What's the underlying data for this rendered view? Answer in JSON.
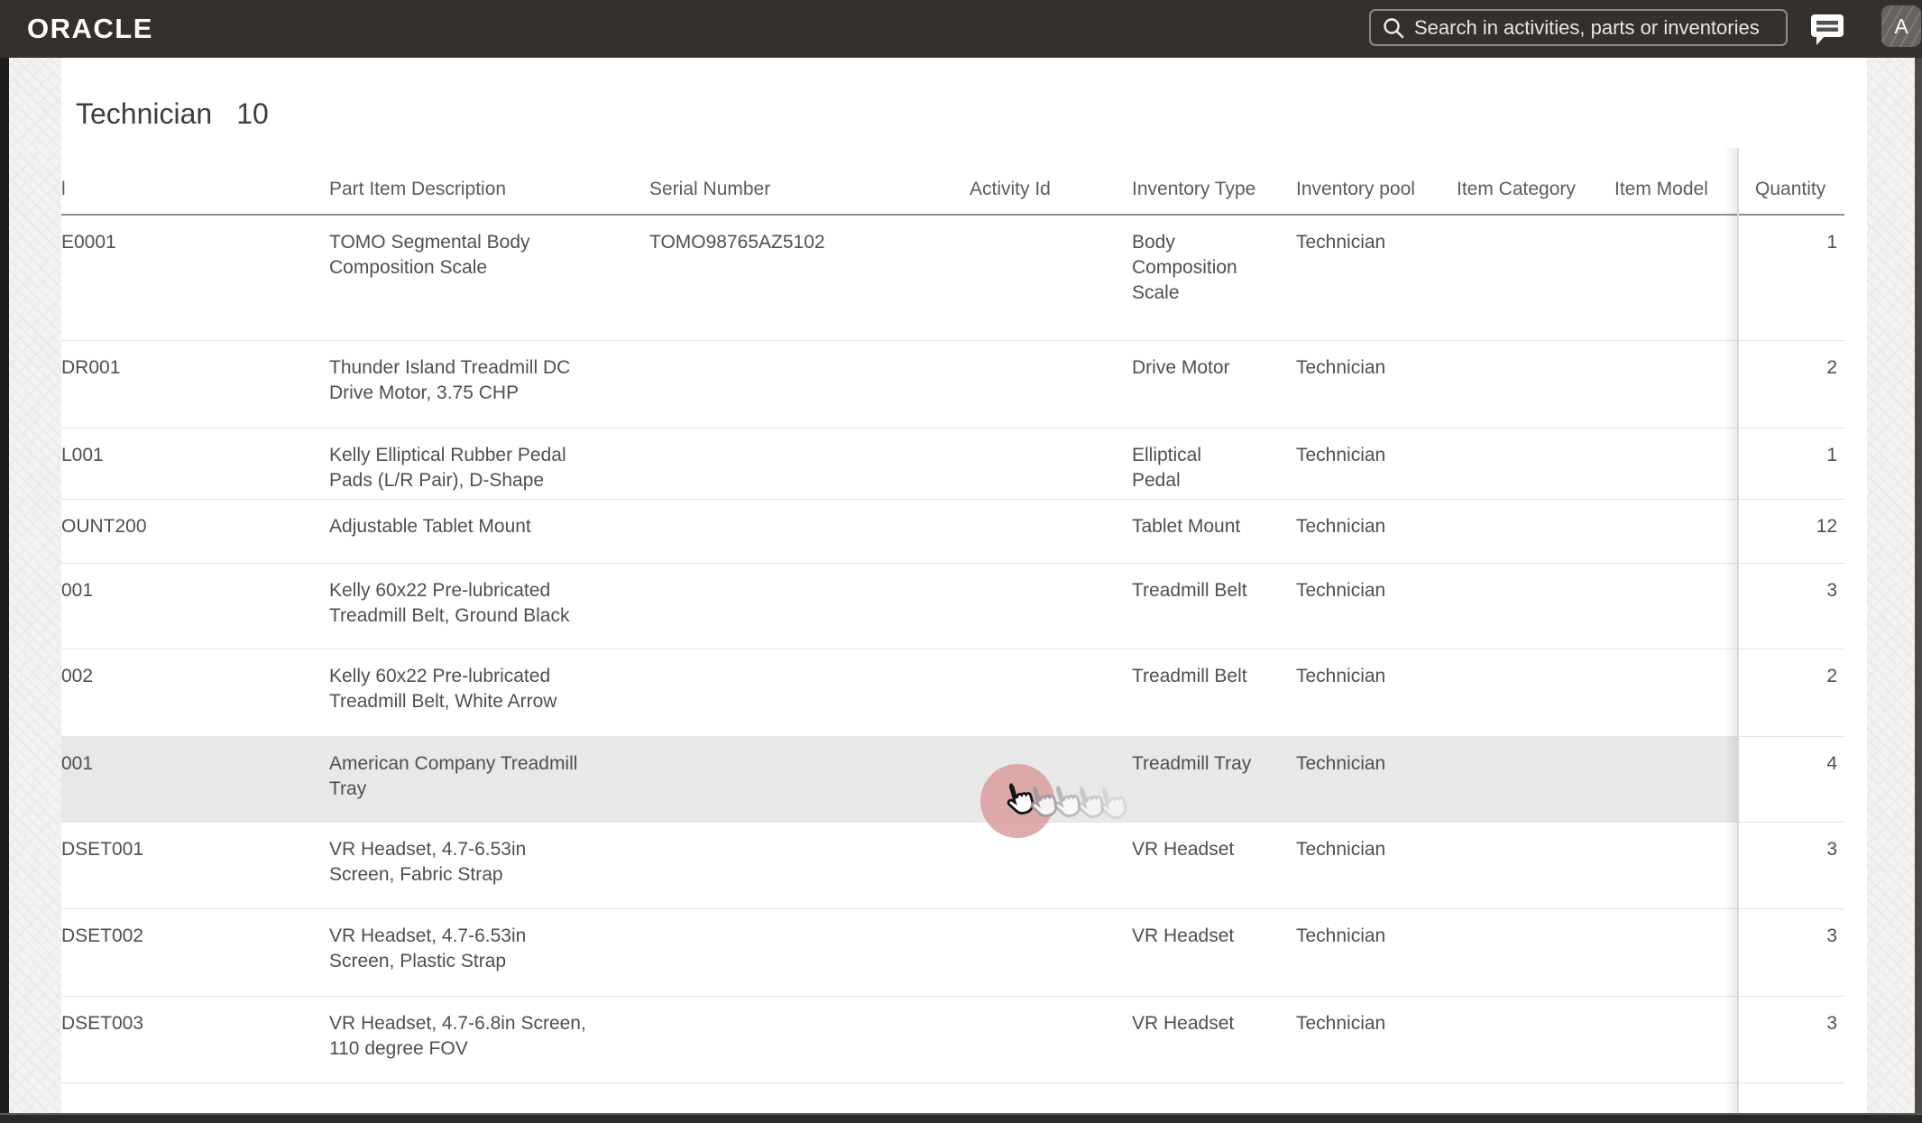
{
  "topbar": {
    "brand": "ORACLE",
    "search_placeholder": "Search in activities, parts or inventories",
    "avatar_letter": "A"
  },
  "page": {
    "title": "Technician",
    "count": "10"
  },
  "table": {
    "headers": {
      "id": "l",
      "desc": "Part Item Description",
      "serial": "Serial Number",
      "activity": "Activity Id",
      "inv_type": "Inventory Type",
      "pool": "Inventory pool",
      "category": "Item Category",
      "model": "Item Model",
      "qty": "Quantity"
    },
    "rows": [
      {
        "id": "E0001",
        "desc": "TOMO Segmental Body\nComposition Scale",
        "serial": "TOMO98765AZ5102",
        "activity": "",
        "inv_type": "Body\nComposition\nScale",
        "pool": "Technician",
        "category": "",
        "model": "",
        "qty": "1"
      },
      {
        "id": "DR001",
        "desc": "Thunder Island Treadmill DC\nDrive Motor, 3.75 CHP",
        "serial": "",
        "activity": "",
        "inv_type": "Drive Motor",
        "pool": "Technician",
        "category": "",
        "model": "",
        "qty": "2"
      },
      {
        "id": "L001",
        "desc": "Kelly Elliptical Rubber Pedal\nPads (L/R Pair), D-Shape",
        "serial": "",
        "activity": "",
        "inv_type": "Elliptical\nPedal",
        "pool": "Technician",
        "category": "",
        "model": "",
        "qty": "1"
      },
      {
        "id": "OUNT200",
        "desc": "Adjustable Tablet Mount",
        "serial": "",
        "activity": "",
        "inv_type": "Tablet Mount",
        "pool": "Technician",
        "category": "",
        "model": "",
        "qty": "12"
      },
      {
        "id": "001",
        "desc": "Kelly 60x22 Pre-lubricated\nTreadmill Belt, Ground Black",
        "serial": "",
        "activity": "",
        "inv_type": "Treadmill Belt",
        "pool": "Technician",
        "category": "",
        "model": "",
        "qty": "3"
      },
      {
        "id": "002",
        "desc": "Kelly 60x22 Pre-lubricated\nTreadmill Belt, White Arrow",
        "serial": "",
        "activity": "",
        "inv_type": "Treadmill Belt",
        "pool": "Technician",
        "category": "",
        "model": "",
        "qty": "2"
      },
      {
        "id": "001",
        "desc": "American Company Treadmill\nTray",
        "serial": "",
        "activity": "",
        "inv_type": "Treadmill Tray",
        "pool": "Technician",
        "category": "",
        "model": "",
        "qty": "4",
        "highlighted": true
      },
      {
        "id": "DSET001",
        "desc": "VR Headset, 4.7-6.53in\nScreen, Fabric Strap",
        "serial": "",
        "activity": "",
        "inv_type": "VR Headset",
        "pool": "Technician",
        "category": "",
        "model": "",
        "qty": "3"
      },
      {
        "id": "DSET002",
        "desc": "VR Headset, 4.7-6.53in\nScreen, Plastic Strap",
        "serial": "",
        "activity": "",
        "inv_type": "VR Headset",
        "pool": "Technician",
        "category": "",
        "model": "",
        "qty": "3"
      },
      {
        "id": "DSET003",
        "desc": "VR Headset, 4.7-6.8in Screen,\n110 degree FOV",
        "serial": "",
        "activity": "",
        "inv_type": "VR Headset",
        "pool": "Technician",
        "category": "",
        "model": "",
        "qty": "3"
      }
    ]
  },
  "colors": {
    "topbar_bg": "#34302d",
    "row_highlight": "#e9e8e8",
    "click_indicator": "#d99c9c"
  }
}
